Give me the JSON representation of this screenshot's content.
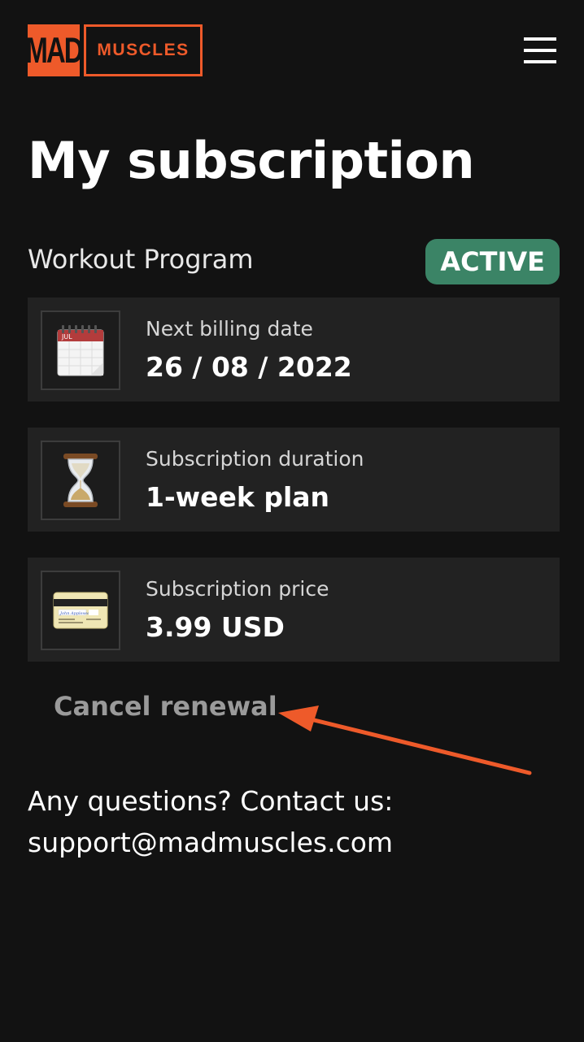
{
  "header": {
    "logo_mad": "MAD",
    "logo_muscles": "MUSCLES"
  },
  "page": {
    "title": "My subscription"
  },
  "program": {
    "name": "Workout Program",
    "status": "ACTIVE",
    "status_color": "#3b8466"
  },
  "cards": [
    {
      "icon": "calendar-icon",
      "icon_month": "JUL",
      "label": "Next billing date",
      "value": "26 / 08 / 2022"
    },
    {
      "icon": "hourglass-icon",
      "label": "Subscription duration",
      "value": "1-week plan"
    },
    {
      "icon": "credit-card-icon",
      "card_name": "John Appleseed",
      "label": "Subscription price",
      "value": "3.99 USD"
    }
  ],
  "actions": {
    "cancel_label": "Cancel renewal"
  },
  "contact": {
    "prompt": "Any questions? Contact us:",
    "email": "support@madmuscles.com"
  },
  "colors": {
    "background": "#121212",
    "brand_orange": "#ee5a2a",
    "card_background": "#222222",
    "annotation_arrow": "#ee5a2a"
  }
}
